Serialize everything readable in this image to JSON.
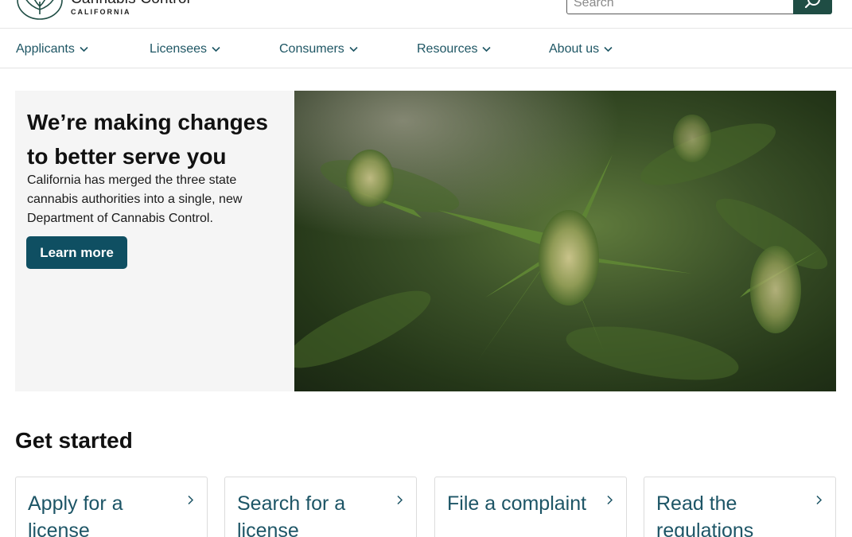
{
  "header": {
    "brand_name": "Cannabis Control",
    "brand_sub": "CALIFORNIA",
    "search_placeholder": "Search"
  },
  "nav": {
    "items": [
      {
        "label": "Applicants"
      },
      {
        "label": "Licensees"
      },
      {
        "label": "Consumers"
      },
      {
        "label": "Resources"
      },
      {
        "label": "About us"
      }
    ]
  },
  "hero": {
    "title": "We’re making changes to better serve you",
    "text": "California has merged the three state cannabis authorities into a single, new Department of Cannabis Control.",
    "button_label": "Learn more"
  },
  "get_started": {
    "title": "Get started",
    "cards": [
      {
        "label": "Apply for a license"
      },
      {
        "label": "Search for a license"
      },
      {
        "label": "File a complaint"
      },
      {
        "label": "Read the regulations"
      }
    ]
  },
  "colors": {
    "brand_green": "#1f4d44",
    "nav_link": "#1e5664",
    "button": "#0f4f62",
    "card_text": "#1d5566"
  }
}
